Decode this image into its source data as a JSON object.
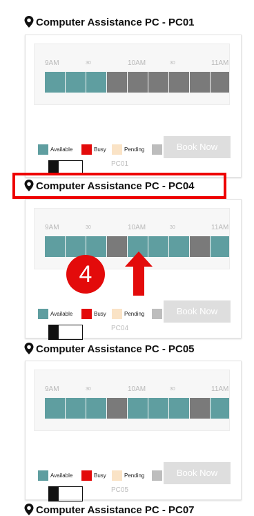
{
  "top_fragment": "",
  "time_ticks": [
    "9AM",
    "30",
    "10AM",
    "30",
    "11AM"
  ],
  "legend": {
    "available": "Available",
    "busy": "Busy",
    "pending": "Pending"
  },
  "book_label": "Book Now",
  "colors": {
    "available": "#5f9ea0",
    "booked": "#7a7a7a",
    "busy": "#e30b0b",
    "pending": "#fae3c6",
    "unavailable": "#bdbdbd"
  },
  "cards": [
    {
      "title": "Computer Assistance PC - PC01",
      "pc_id": "PC01",
      "slots": [
        "available",
        "available",
        "available",
        "booked",
        "booked",
        "booked",
        "booked",
        "booked",
        "booked",
        "booked"
      ]
    },
    {
      "title": "Computer Assistance PC - PC04",
      "pc_id": "PC04",
      "slots": [
        "available",
        "available",
        "available",
        "booked",
        "available",
        "available",
        "available",
        "booked",
        "available",
        "available"
      ]
    },
    {
      "title": "Computer Assistance PC - PC05",
      "pc_id": "PC05",
      "slots": [
        "available",
        "available",
        "available",
        "booked",
        "available",
        "available",
        "available",
        "booked",
        "available",
        "available"
      ]
    }
  ],
  "next_title": "Computer Assistance PC - PC07",
  "annotation": {
    "step_number": "4"
  }
}
